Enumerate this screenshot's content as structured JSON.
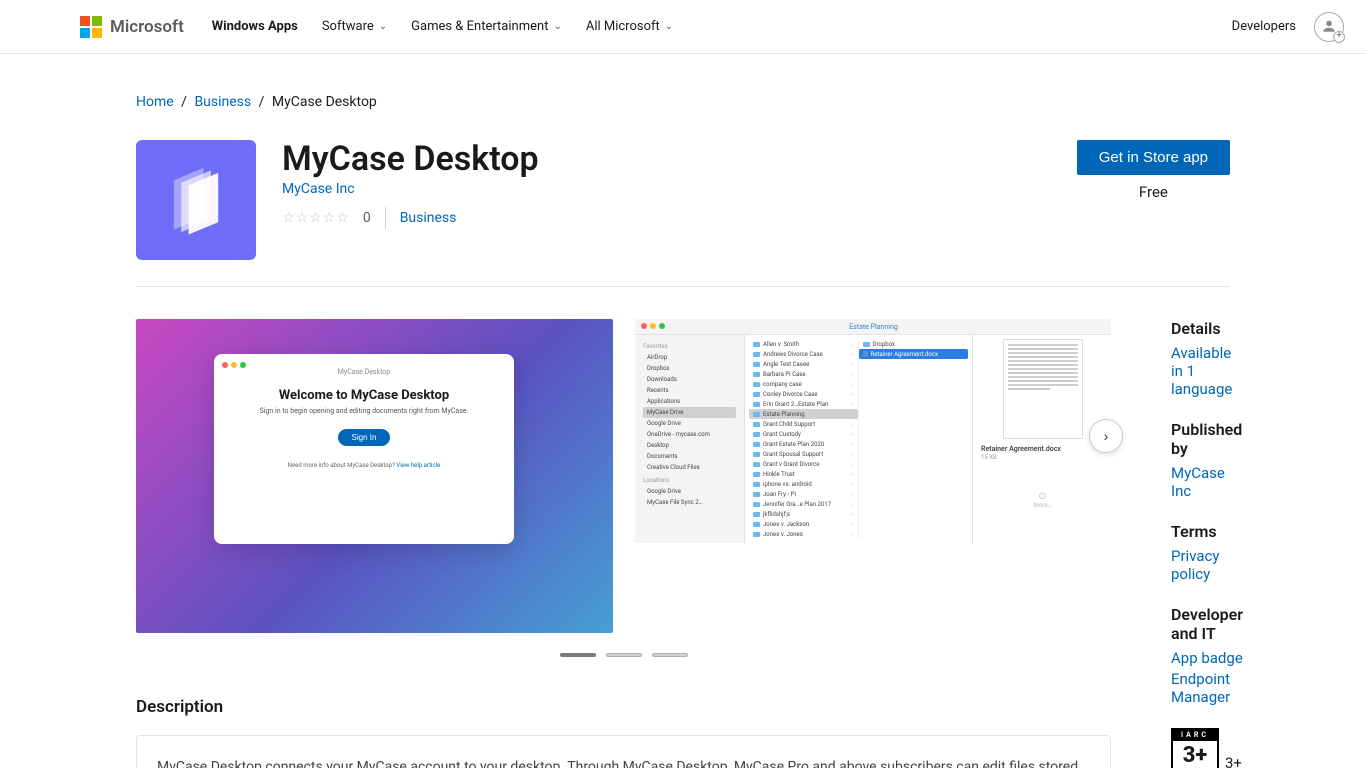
{
  "header": {
    "brand": "Microsoft",
    "nav": [
      {
        "label": "Windows Apps",
        "has_chevron": false,
        "active": true
      },
      {
        "label": "Software",
        "has_chevron": true,
        "active": false
      },
      {
        "label": "Games & Entertainment",
        "has_chevron": true,
        "active": false
      },
      {
        "label": "All Microsoft",
        "has_chevron": true,
        "active": false
      }
    ],
    "developers_link": "Developers"
  },
  "breadcrumb": {
    "home": "Home",
    "category": "Business",
    "current": "MyCase Desktop"
  },
  "app": {
    "title": "MyCase Desktop",
    "publisher": "MyCase Inc",
    "rating_count": "0",
    "category": "Business",
    "cta_label": "Get in Store app",
    "price": "Free"
  },
  "screenshot1": {
    "win_title": "MyCase Desktop",
    "heading": "Welcome to MyCase Desktop",
    "subtext": "Sign in to begin opening and editing documents right from MyCase.",
    "button": "Sign In",
    "help_prefix": "Need more info about MyCase Desktop? ",
    "help_link": "View help article"
  },
  "screenshot2": {
    "titlebar": "Estate Planning",
    "sidebar_groups": [
      {
        "header": "Favorites",
        "items": [
          "AirDrop",
          "Dropbox",
          "Downloads",
          "Recents",
          "Applications",
          "MyCase Drive",
          "Google Drive",
          "OneDrive - mycase.com",
          "Desktop",
          "Documents",
          "Creative Cloud Files"
        ],
        "selected": "MyCase Drive"
      },
      {
        "header": "Locations",
        "items": [
          "Google Drive",
          "MyCase File Sync 2…"
        ]
      }
    ],
    "folders_top": "Dropbox",
    "folders_hilite": "Retainer Agreement.docx",
    "folders": [
      "Allen v. Smith",
      "Andrews Divorce Case",
      "Angle Test Casee",
      "Barbara Pi Case",
      "company case",
      "Conley Divorce Case",
      "Erin Grant 2…Estate Plan",
      "Estate Planning",
      "Grant Child Support",
      "Grant Custody",
      "Grant Estate Plan 2020",
      "Grant Spousal Support",
      "Grant v Grant Divorce",
      "Hinkle Trust",
      "iphone vs. android",
      "Joan Fry - PI",
      "Jennifer Gra…e Plan 2017",
      "jkflidshjf;s",
      "Jones v. Jackson",
      "Jones v. Jones"
    ],
    "folder_selected": "Estate Planning",
    "preview_name": "Retainer Agreement.docx",
    "preview_size": "15 KB",
    "more": "More…"
  },
  "details": {
    "heading_details": "Details",
    "languages": "Available in 1 language",
    "heading_publisher": "Published by",
    "publisher_link": "MyCase Inc",
    "heading_terms": "Terms",
    "privacy": "Privacy policy",
    "heading_dev": "Developer and IT",
    "app_badge": "App badge",
    "endpoint": "Endpoint Manager",
    "rating_label": "3+",
    "iarc_num": "3+",
    "iarc_top": "IARC"
  },
  "description": {
    "heading": "Description",
    "body": "MyCase Desktop connects your MyCase account to your desktop. Through MyCase Desktop, MyCase Pro and above subscribers can edit files stored"
  }
}
